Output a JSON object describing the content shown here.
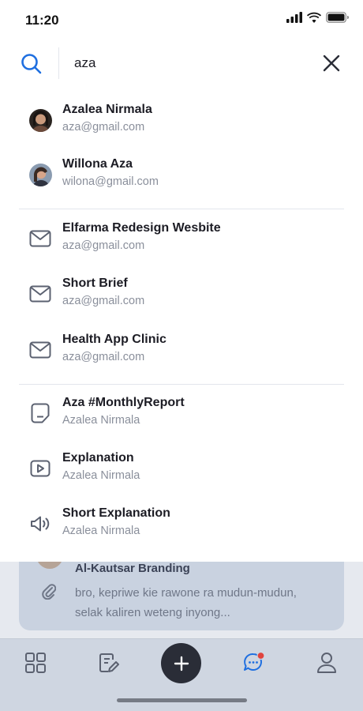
{
  "status_bar": {
    "time": "11:20"
  },
  "search": {
    "query": "aza"
  },
  "results": [
    {
      "type": "person",
      "icon": "avatar",
      "title": "Azalea Nirmala",
      "subtitle": "aza@gmail.com"
    },
    {
      "type": "person",
      "icon": "avatar",
      "title": "Willona Aza",
      "subtitle": "wilona@gmail.com"
    },
    {
      "type": "email",
      "icon": "mail-icon",
      "title": "Elfarma Redesign Wesbite",
      "subtitle": "aza@gmail.com"
    },
    {
      "type": "email",
      "icon": "mail-icon",
      "title": "Short Brief",
      "subtitle": "aza@gmail.com"
    },
    {
      "type": "email",
      "icon": "mail-icon",
      "title": "Health App Clinic",
      "subtitle": "aza@gmail.com"
    },
    {
      "type": "document",
      "icon": "document-icon",
      "title": "Aza #MonthlyReport",
      "subtitle": "Azalea Nirmala"
    },
    {
      "type": "video",
      "icon": "video-icon",
      "title": "Explanation",
      "subtitle": "Azalea Nirmala"
    },
    {
      "type": "audio",
      "icon": "speaker-icon",
      "title": "Short Explanation",
      "subtitle": "Azalea Nirmala"
    }
  ],
  "background_message": {
    "title": "Al-Kautsar Branding",
    "preview": "bro, kepriwe kie rawone ra mudun-mudun, selak kaliren weteng inyong..."
  },
  "bottom_nav": {
    "items": [
      "grid-icon",
      "notes-edit-icon",
      "add-icon",
      "chat-icon",
      "profile-icon"
    ],
    "active": "chat-icon"
  },
  "colors": {
    "accent": "#1f6fe0",
    "notification_dot": "#e0443e",
    "fab": "#2a2d37"
  }
}
